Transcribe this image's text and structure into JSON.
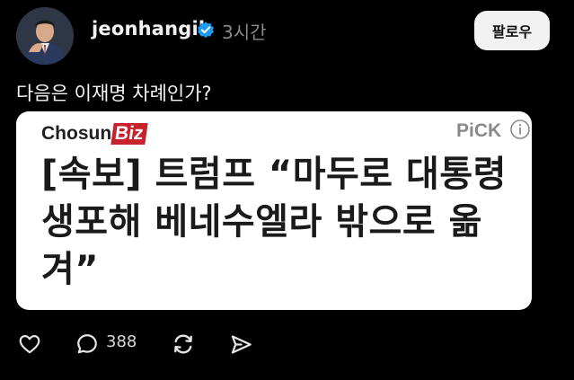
{
  "post": {
    "username": "jeonhangil",
    "time": "3시간",
    "follow_label": "팔로우",
    "text": "다음은 이재명 차례인가?"
  },
  "card": {
    "brand_part1": "Chosun",
    "brand_part2": "Biz",
    "pick_label": "PiCK",
    "headline": "[속보] 트럼프 “마두로 대통령 생포해 베네수엘라 밖으로 옮겨”"
  },
  "actions": {
    "reply_count": "388"
  },
  "icons": {
    "verified": "verified-badge-icon",
    "info": "info-icon",
    "like": "heart-icon",
    "reply": "comment-icon",
    "repost": "repost-icon",
    "share": "share-icon"
  },
  "colors": {
    "background": "#000000",
    "verified": "#1d9bf0",
    "brand_red": "#c8232c"
  }
}
